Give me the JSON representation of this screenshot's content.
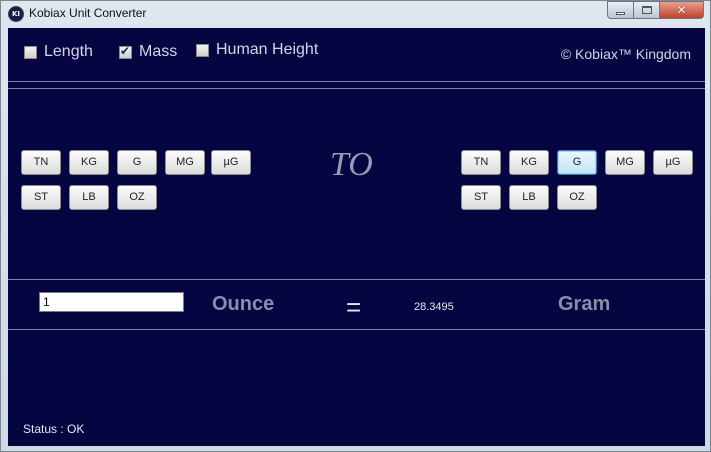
{
  "window": {
    "title": "Kobiax Unit Converter",
    "icon_text": "KI",
    "controls": {
      "minimize": "minimize-icon",
      "maximize": "maximize-icon",
      "close": "✕"
    }
  },
  "categories": [
    {
      "label": "Length",
      "checked": false
    },
    {
      "label": "Mass",
      "checked": true
    },
    {
      "label": "Human Height",
      "checked": false
    }
  ],
  "copyright": "© Kobiax™ Kingdom",
  "from_units": [
    "TN",
    "KG",
    "G",
    "MG",
    "µG",
    "ST",
    "LB",
    "OZ"
  ],
  "to_units": [
    "TN",
    "KG",
    "G",
    "MG",
    "µG",
    "ST",
    "LB",
    "OZ"
  ],
  "to_label": "TO",
  "selected_to_unit": "G",
  "conversion": {
    "input_value": "1",
    "from_unit_name": "Ounce",
    "equals": "=",
    "result": "28.3495",
    "to_unit_name": "Gram"
  },
  "status": "Status : OK",
  "colors": {
    "background": "#050542",
    "accent": "#3c7fb1"
  }
}
